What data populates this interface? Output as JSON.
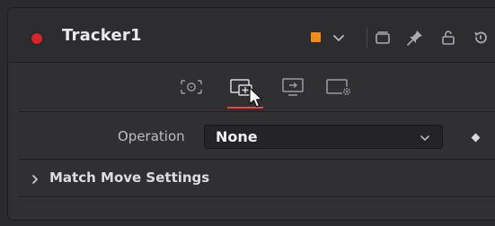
{
  "header": {
    "title": "Tracker1",
    "swatch_color": "#f28a1c",
    "dot_color": "#d8242b",
    "icons": [
      "version-icon",
      "pin-icon",
      "lock-icon",
      "reset-icon"
    ]
  },
  "tabs": [
    {
      "name": "tab-tracker",
      "icon": "target-icon"
    },
    {
      "name": "tab-operation",
      "icon": "operation-icon",
      "active": true
    },
    {
      "name": "tab-display",
      "icon": "display-icon"
    },
    {
      "name": "tab-settings",
      "icon": "settings-icon"
    }
  ],
  "operation": {
    "label": "Operation",
    "value": "None"
  },
  "match_move": {
    "label": "Match Move Settings"
  }
}
